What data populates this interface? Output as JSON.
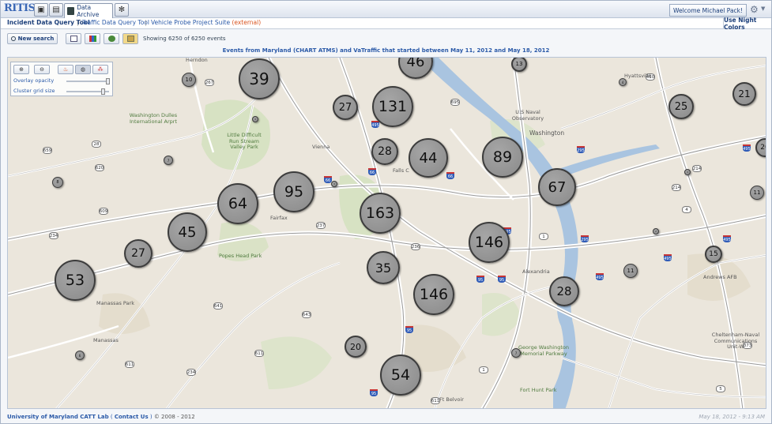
{
  "app": {
    "logo_text": "RITIS",
    "tab_active_label": "Data Archive",
    "welcome_text": "Welcome Michael Pack!"
  },
  "nav": {
    "incident": "Incident Data Query Tool",
    "traffic": "Traffic Data Query Tool",
    "probe": "Vehicle Probe Project Suite",
    "probe_note": "(external)",
    "night_colors": "Use Night Colors"
  },
  "toolbar": {
    "new_search": "New search",
    "showing": "Showing 6250 of 6250 events"
  },
  "caption": "Events from Maryland (CHART ATMS) and VaTraffic that started between May 11, 2012 and May 18, 2012",
  "overlay": {
    "opacity_label": "Overlay opacity",
    "grid_label": "Cluster grid size"
  },
  "map": {
    "clusters": [
      {
        "v": "39"
      },
      {
        "v": "46"
      },
      {
        "v": "13"
      },
      {
        "v": "10"
      },
      {
        "v": "27"
      },
      {
        "v": "131"
      },
      {
        "v": "25"
      },
      {
        "v": "21"
      },
      {
        "v": "28"
      },
      {
        "v": "44"
      },
      {
        "v": "89"
      },
      {
        "v": "20"
      },
      {
        "v": "67"
      },
      {
        "v": "95"
      },
      {
        "v": "64"
      },
      {
        "v": "163"
      },
      {
        "v": "11"
      },
      {
        "v": "45"
      },
      {
        "v": "146"
      },
      {
        "v": "15"
      },
      {
        "v": "27"
      },
      {
        "v": "53"
      },
      {
        "v": "35"
      },
      {
        "v": "11"
      },
      {
        "v": "146"
      },
      {
        "v": "28"
      },
      {
        "v": "20"
      },
      {
        "v": "54"
      },
      {
        "v": "8"
      },
      {
        "v": "7"
      },
      {
        "v": "4"
      },
      {
        "v": "3"
      },
      {
        "v": "6"
      },
      {
        "v": "7"
      },
      {
        "v": "3"
      },
      {
        "v": "2"
      },
      {
        "v": "3"
      }
    ],
    "labels": [
      "Herndon",
      "Washington Dulles International Arprt",
      "Little Difficult Run Stream Valley Park",
      "Vienna",
      "Falls C",
      "U.S Naval Observatory",
      "Washington",
      "Hyattsville",
      "Fairfax",
      "Popes Head Park",
      "Alexandria",
      "Andrews AFB",
      "Manassas Park",
      "Manassas",
      "George Washington Memorial Parkway",
      "Fort Hunt Park",
      "Ft Belvoir",
      "Cheltenham-Naval Communications Unit-W"
    ]
  },
  "footer": {
    "org": "University of Maryland CATT Lab",
    "contact": "Contact Us",
    "copyright": "© 2008 - 2012",
    "timestamp": "May 18, 2012 - 9:13 AM"
  }
}
